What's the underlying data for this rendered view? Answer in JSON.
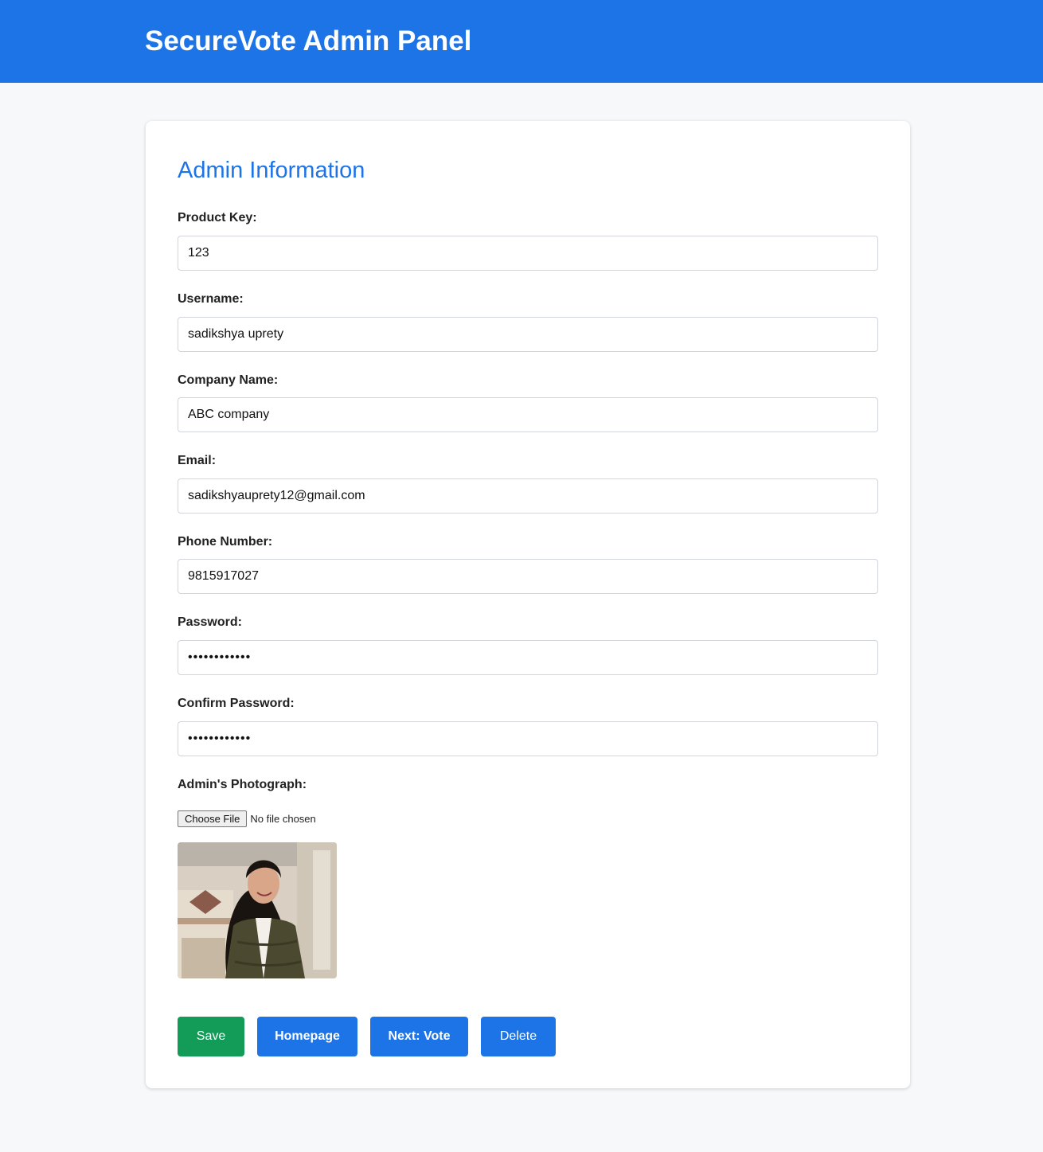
{
  "header": {
    "title": "SecureVote Admin Panel"
  },
  "form": {
    "title": "Admin Information",
    "fields": [
      {
        "label": "Product Key:",
        "value": "123",
        "type": "text"
      },
      {
        "label": "Username:",
        "value": "sadikshya uprety",
        "type": "text"
      },
      {
        "label": "Company Name:",
        "value": "ABC company",
        "type": "text"
      },
      {
        "label": "Email:",
        "value": "sadikshyauprety12@gmail.com",
        "type": "email"
      },
      {
        "label": "Phone Number:",
        "value": "9815917027",
        "type": "tel"
      },
      {
        "label": "Password:",
        "value": "••••••••••••",
        "type": "password"
      },
      {
        "label": "Confirm Password:",
        "value": "••••••••••••",
        "type": "password"
      }
    ],
    "photo": {
      "label": "Admin's Photograph:",
      "file_button": "Choose File",
      "file_status": "No file chosen"
    }
  },
  "actions": {
    "save": "Save",
    "homepage": "Homepage",
    "next": "Next: Vote",
    "delete": "Delete"
  },
  "colors": {
    "primary": "#1d74e7",
    "success": "#129c58",
    "page_bg": "#f7f8fa"
  }
}
